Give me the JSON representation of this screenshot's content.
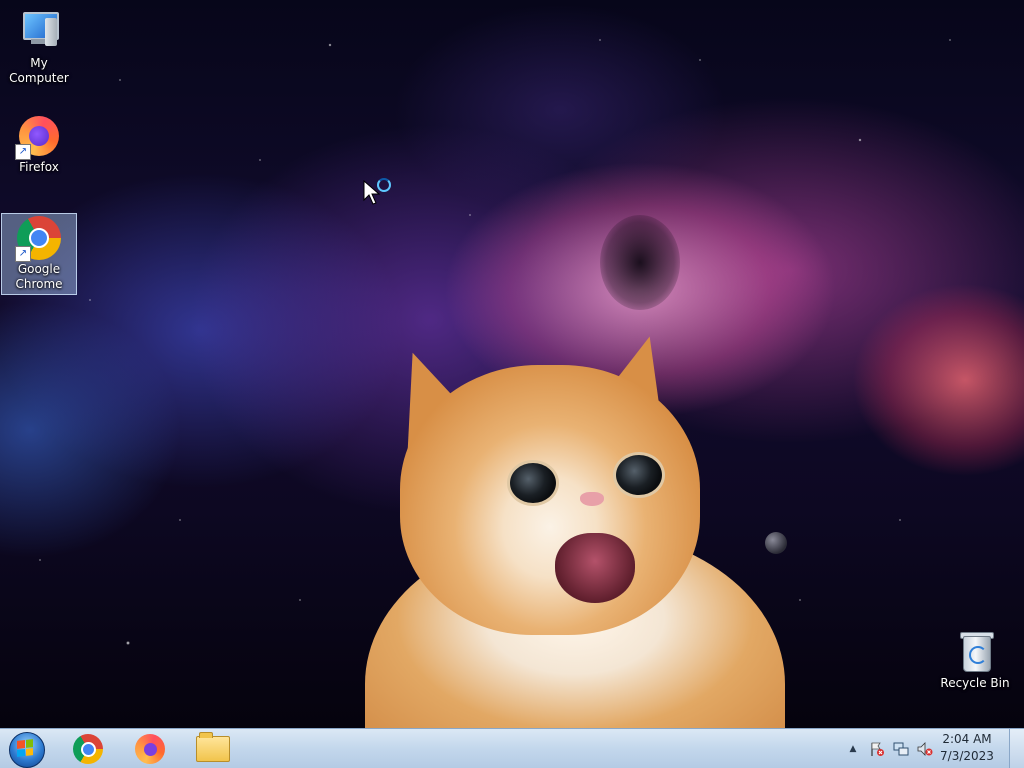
{
  "desktop": {
    "icons": [
      {
        "label": "My Computer",
        "icon": "my-computer-icon"
      },
      {
        "label": "Firefox",
        "icon": "firefox-icon"
      },
      {
        "label": "Google Chrome",
        "icon": "chrome-icon",
        "selected": true
      },
      {
        "label": "Recycle Bin",
        "icon": "recycle-bin-icon"
      }
    ],
    "wallpaper": "space nebula with orange cat"
  },
  "taskbar": {
    "start_icon": "windows-start-orb",
    "pinned": [
      {
        "name": "Google Chrome",
        "icon": "chrome-icon"
      },
      {
        "name": "Firefox",
        "icon": "firefox-icon"
      },
      {
        "name": "Windows Explorer",
        "icon": "folder-icon"
      }
    ],
    "tray": {
      "show_hidden_glyph": "▲",
      "icons": [
        "action-center-flag-icon",
        "network-icon",
        "volume-muted-icon"
      ]
    },
    "clock": {
      "time": "2:04 AM",
      "date": "7/3/2023"
    }
  },
  "colors": {
    "taskbar": "#c3d7ec",
    "selection": "#aac8f0"
  }
}
